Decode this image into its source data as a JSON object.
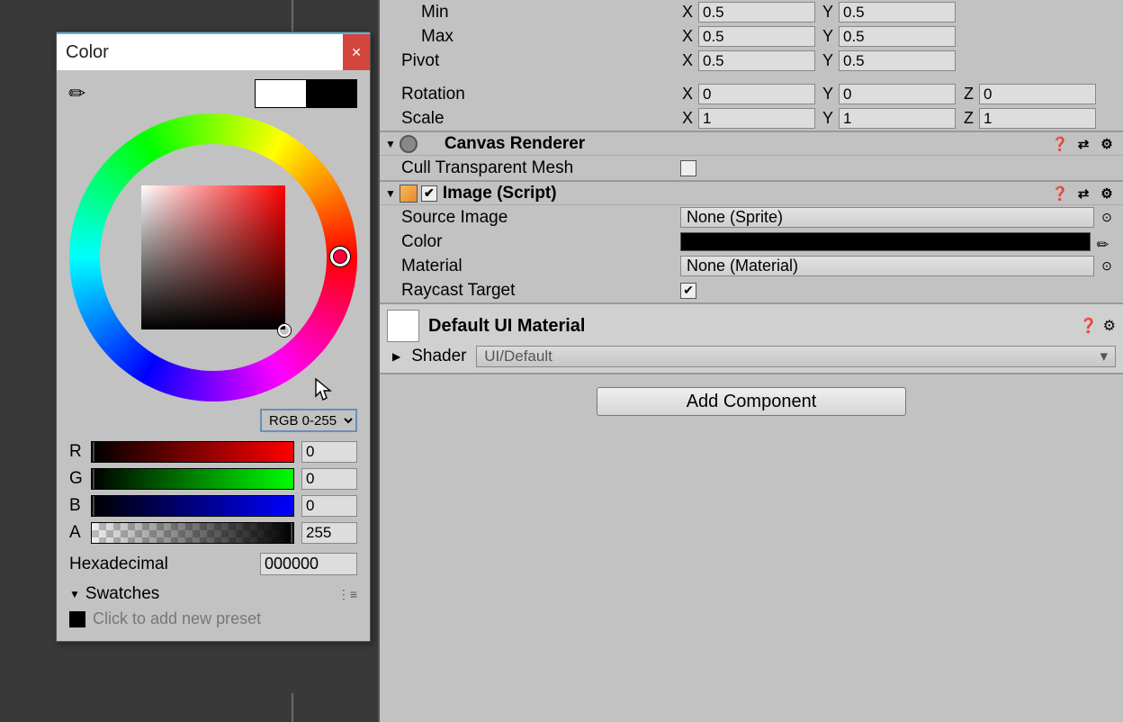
{
  "colorPicker": {
    "title": "Color",
    "oldColor": "#ffffff",
    "newColor": "#000000",
    "modeSelect": "RGB 0-255",
    "channels": {
      "r": {
        "label": "R",
        "value": "0"
      },
      "g": {
        "label": "G",
        "value": "0"
      },
      "b": {
        "label": "B",
        "value": "0"
      },
      "a": {
        "label": "A",
        "value": "255"
      }
    },
    "hexLabel": "Hexadecimal",
    "hexValue": "000000",
    "swatchesLabel": "Swatches",
    "addPresetText": "Click to add new preset"
  },
  "transform": {
    "min": {
      "label": "Min",
      "x": "0.5",
      "y": "0.5"
    },
    "max": {
      "label": "Max",
      "x": "0.5",
      "y": "0.5"
    },
    "pivot": {
      "label": "Pivot",
      "x": "0.5",
      "y": "0.5"
    },
    "rotation": {
      "label": "Rotation",
      "x": "0",
      "y": "0",
      "z": "0"
    },
    "scale": {
      "label": "Scale",
      "x": "1",
      "y": "1",
      "z": "1"
    }
  },
  "canvasRenderer": {
    "title": "Canvas Renderer",
    "cullLabel": "Cull Transparent Mesh",
    "cullValue": false
  },
  "image": {
    "title": "Image (Script)",
    "enabled": true,
    "sourceImageLabel": "Source Image",
    "sourceImageValue": "None (Sprite)",
    "colorLabel": "Color",
    "colorValue": "#000000",
    "materialLabel": "Material",
    "materialValue": "None (Material)",
    "raycastLabel": "Raycast Target",
    "raycastValue": true
  },
  "material": {
    "name": "Default UI Material",
    "shaderLabel": "Shader",
    "shaderValue": "UI/Default"
  },
  "addComponent": "Add Component",
  "axis": {
    "x": "X",
    "y": "Y",
    "z": "Z"
  }
}
